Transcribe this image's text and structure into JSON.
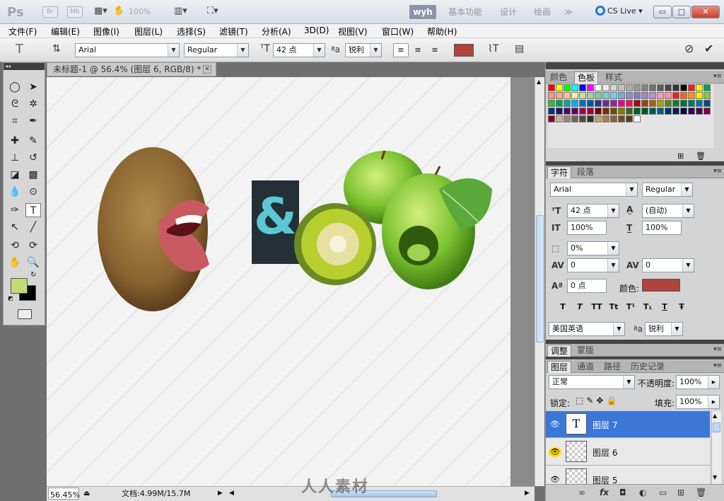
{
  "app": {
    "logo": "Ps",
    "bridge_label": "Br",
    "minibridge_label": "Mb",
    "zoom_display": "100%",
    "workspaces": [
      {
        "label": "wyh",
        "active": true
      },
      {
        "label": "基本功能",
        "active": false
      },
      {
        "label": "设计",
        "active": false
      },
      {
        "label": "绘画",
        "active": false
      }
    ],
    "more_glyph": "≫",
    "cs_live": "CS Live",
    "window_buttons": [
      "▭",
      "□",
      "✕"
    ]
  },
  "menu": [
    "文件(F)",
    "编辑(E)",
    "图像(I)",
    "图层(L)",
    "选择(S)",
    "滤镜(T)",
    "分析(A)",
    "3D(D)",
    "视图(V)",
    "窗口(W)",
    "帮助(H)"
  ],
  "options": {
    "tool_glyph": "T",
    "font_family": "Arial",
    "font_style": "Regular",
    "font_size": "42 点",
    "aa_icon": "ªa",
    "antialias": "锐利",
    "text_color": "#b0443c"
  },
  "document": {
    "tab_title": "未标题-1 @ 56.4% (图层 6, RGB/8) *",
    "ampersand": "&",
    "ampersand_bg": "#253036",
    "ampersand_color": "#5cc8d4",
    "zoom": "56.45%",
    "doc_info": "文档:4.99M/15.7M",
    "watermark": "人人素材"
  },
  "swatches_panel": {
    "tabs": [
      {
        "label": "颜色",
        "active": false
      },
      {
        "label": "色板",
        "active": true
      },
      {
        "label": "样式",
        "active": false
      }
    ],
    "colors": [
      "#ff0000",
      "#ffff00",
      "#00ff00",
      "#00ffff",
      "#0000ff",
      "#ff00ff",
      "#ffffff",
      "#ebebeb",
      "#d6d6d6",
      "#c2c2c2",
      "#adadad",
      "#999999",
      "#858585",
      "#707070",
      "#5c5c5c",
      "#474747",
      "#333333",
      "#000000",
      "#ed1c24",
      "#fff200",
      "#00a651",
      "#f7977a",
      "#f9ad81",
      "#fdc68a",
      "#fff79a",
      "#c4df9b",
      "#a3d39c",
      "#82ca9d",
      "#7bcdc8",
      "#6ecff6",
      "#7ea7d8",
      "#8493ca",
      "#8882be",
      "#a187be",
      "#bc8dbf",
      "#f49ac2",
      "#f6989d",
      "#ed1c24",
      "#f26522",
      "#f7941d",
      "#fff200",
      "#8dc63f",
      "#39b54a",
      "#00a651",
      "#00a99d",
      "#00aeef",
      "#0072bc",
      "#0054a6",
      "#2e3192",
      "#662d91",
      "#92278f",
      "#ec008c",
      "#ed145b",
      "#9e0b0f",
      "#a0410d",
      "#a3620a",
      "#aba000",
      "#598527",
      "#1a7b30",
      "#007236",
      "#00746b",
      "#0076a3",
      "#004b80",
      "#003471",
      "#1b1464",
      "#440e62",
      "#630460",
      "#9e005d",
      "#9e0039",
      "#790000",
      "#7b2e00",
      "#7d4900",
      "#827b00",
      "#406618",
      "#005e20",
      "#005826",
      "#005952",
      "#005b7f",
      "#003663",
      "#002157",
      "#0d004c",
      "#32004b",
      "#4b0049",
      "#7b0046",
      "#7a0026",
      "#c7b299",
      "#998675",
      "#736357",
      "#534741",
      "#37302a",
      "#c69c6d",
      "#a67c52",
      "#8c6239",
      "#754c24",
      "#603913",
      "#ffffff"
    ]
  },
  "character_panel": {
    "tabs": [
      {
        "label": "字符",
        "active": true
      },
      {
        "label": "段落",
        "active": false
      }
    ],
    "font_family": "Arial",
    "font_style": "Regular",
    "size": "42 点",
    "leading": "(自动)",
    "vscale": "100%",
    "hscale": "100%",
    "tracking_pct": "0%",
    "kerning": "0",
    "tracking": "0",
    "baseline": "0 点",
    "color_label": "颜色:",
    "color": "#b0443c",
    "glyph_buttons": [
      "T",
      "T",
      "TT",
      "Tt",
      "T¹",
      "T₁",
      "T",
      "Ŧ"
    ],
    "language": "美国英语",
    "aa_icon": "ªa",
    "antialias": "锐利"
  },
  "adjust_panel": {
    "tabs": [
      {
        "label": "调整",
        "active": true
      },
      {
        "label": "蒙版",
        "active": false
      }
    ]
  },
  "layers_panel": {
    "tabs": [
      {
        "label": "图层",
        "active": true
      },
      {
        "label": "通道",
        "active": false
      },
      {
        "label": "路径",
        "active": false
      },
      {
        "label": "历史记录",
        "active": false
      }
    ],
    "blend_mode": "正常",
    "opacity_label": "不透明度:",
    "opacity": "100%",
    "lock_label": "锁定:",
    "fill_label": "填充:",
    "fill": "100%",
    "layers": [
      {
        "name": "图层 7",
        "type": "text",
        "thumb": "T",
        "selected": true
      },
      {
        "name": "图层 6",
        "type": "pixel",
        "thumb": "",
        "selected": false
      },
      {
        "name": "图层 5",
        "type": "pixel",
        "thumb": "",
        "selected": false
      }
    ],
    "footer_icons": [
      "∞",
      "fx",
      "◘",
      "◐",
      "▭",
      "⊞",
      "🗑"
    ]
  }
}
